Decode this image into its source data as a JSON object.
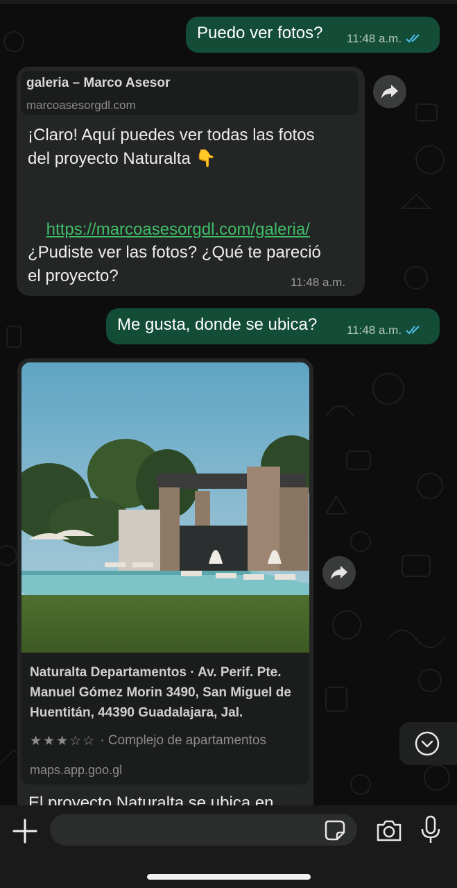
{
  "messages": [
    {
      "text": "Puedo ver fotos?",
      "time": "11:48 a.m."
    },
    {
      "preview_title": "galeria – Marco Asesor",
      "preview_domain": "marcoasesorgdl.com",
      "text_before": "¡Claro! Aquí puedes ver todas las fotos\ndel proyecto Naturalta 👇",
      "link": "https://marcoasesorgdl.com/galeria/",
      "text_after": "¿Pudiste ver las fotos? ¿Qué te pareció\nel proyecto?",
      "time": "11:48 a.m."
    },
    {
      "text": "Me gusta, donde se ubica?",
      "time": "11:48 a.m."
    },
    {
      "map_title": "Naturalta Departamentos · Av. Perif. Pte. Manuel Gómez Morin 3490, San Miguel de Huentitán, 44390 Guadalajara, Jal.",
      "rating": 3,
      "rating_max": 5,
      "place_type": "· Complejo de apartamentos",
      "domain": "maps.app.goo.gl",
      "partial_text": "El proyecto Naturalta se ubica en"
    }
  ],
  "icons": {
    "ticks": "double-check-icon",
    "forward": "forward-icon",
    "scroll": "chevron-down-icon",
    "plus": "plus-icon",
    "sticker": "sticker-icon",
    "camera": "camera-icon",
    "mic": "mic-icon"
  },
  "colors": {
    "outgoing_bubble": "#134d37",
    "incoming_bubble": "#242626",
    "link": "#3fbd68",
    "read_ticks": "#53bdeb"
  }
}
